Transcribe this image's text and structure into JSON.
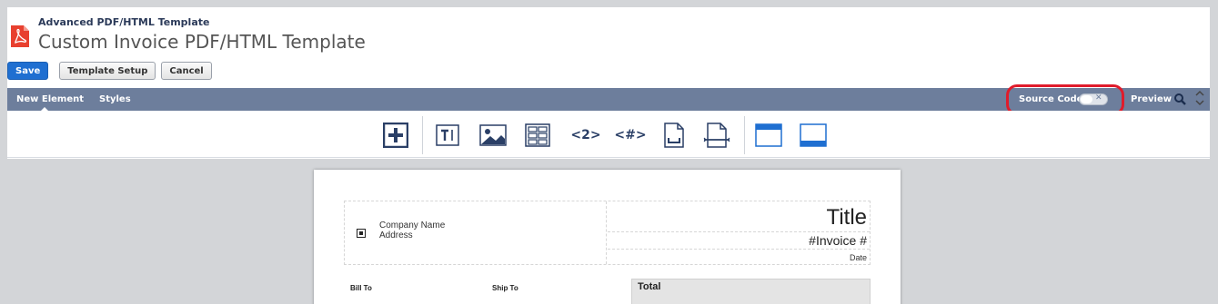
{
  "header": {
    "supertitle": "Advanced PDF/HTML Template",
    "title": "Custom Invoice PDF/HTML Template",
    "icon": "pdf-file-icon"
  },
  "buttons": {
    "save": "Save",
    "template_setup": "Template Setup",
    "cancel": "Cancel"
  },
  "navbar": {
    "tabs": [
      {
        "label": "New Element",
        "active": true
      },
      {
        "label": "Styles",
        "active": false
      }
    ],
    "source_code_label": "Source Code",
    "source_code_toggle": "off",
    "toggle_glyph": "✕",
    "preview_label": "Preview",
    "preview_icon": "magnifier-icon"
  },
  "toolbar": {
    "tools": [
      {
        "name": "add-element-icon"
      },
      {
        "name": "text-block-icon"
      },
      {
        "name": "image-icon"
      },
      {
        "name": "table-icon"
      },
      {
        "name": "page-number-icon",
        "text": "<2>"
      },
      {
        "name": "total-pages-icon",
        "text": "<#>"
      },
      {
        "name": "page-break-icon"
      },
      {
        "name": "insert-page-icon"
      },
      {
        "name": "header-layout-icon"
      },
      {
        "name": "footer-layout-icon"
      }
    ]
  },
  "document": {
    "company_name": "Company Name",
    "address": "Address",
    "title": "Title",
    "invoice_no": "#Invoice #",
    "date": "Date",
    "bill_to": "Bill To",
    "ship_to": "Ship To",
    "total": "Total"
  },
  "colors": {
    "navbar": "#6d7e9c",
    "primary_button": "#1f6fd1",
    "highlight": "#e01b2b",
    "icon_blue": "#2a3f66"
  }
}
